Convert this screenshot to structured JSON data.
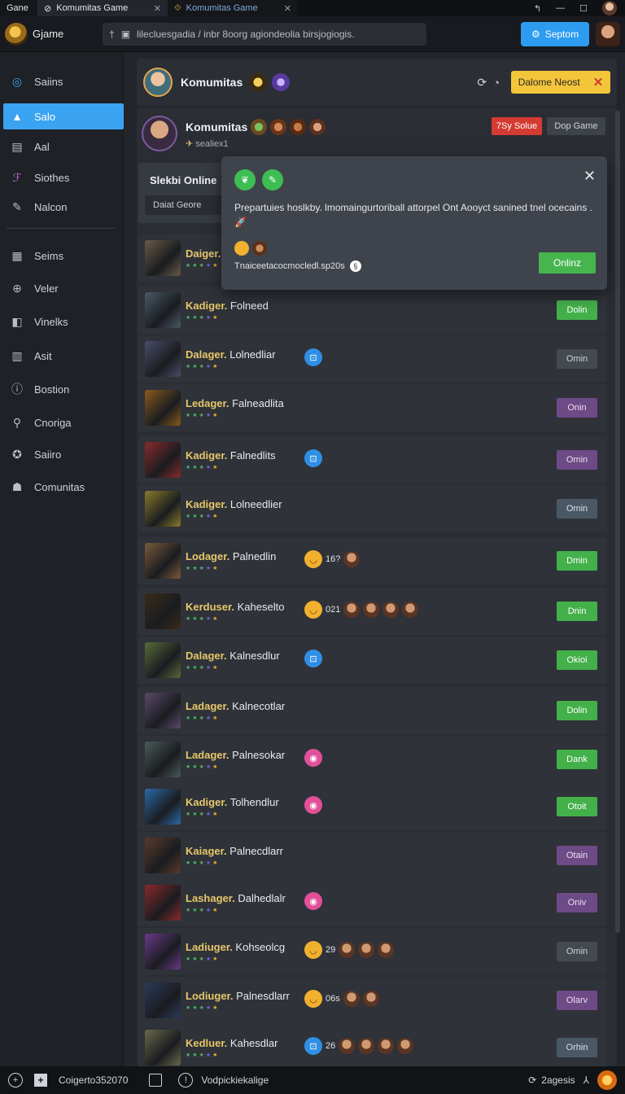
{
  "browser_tabs": [
    {
      "label": "Gane"
    },
    {
      "label": "Komumitas Game"
    },
    {
      "label": "Komumitas Game"
    }
  ],
  "appbar": {
    "brand": "Gjame",
    "address": "lilecluesgadia / inbr 8oorg agiondeolia birsjogiogis.",
    "primary_button": "Septom"
  },
  "sidebar": {
    "items": [
      {
        "label": "Saiins",
        "icon": "circle-icon"
      },
      {
        "label": "Salo",
        "icon": "triangle-icon",
        "active": true
      },
      {
        "label": "Aal",
        "icon": "bookmark-icon"
      },
      {
        "label": "Siothes",
        "icon": "purple-logo-icon"
      },
      {
        "label": "Nalcon",
        "icon": "pencil-icon"
      },
      {
        "label": "Seims",
        "icon": "grid-icon"
      },
      {
        "label": "Veler",
        "icon": "globe-icon"
      },
      {
        "label": "Vinelks",
        "icon": "square-icon"
      },
      {
        "label": "Asit",
        "icon": "bars-icon"
      },
      {
        "label": "Bostion",
        "icon": "info-icon"
      },
      {
        "label": "Cnoriga",
        "icon": "link-icon"
      },
      {
        "label": "Saiiro",
        "icon": "badge-icon"
      },
      {
        "label": "Comunitas",
        "icon": "stack-icon"
      }
    ]
  },
  "header": {
    "title": "Komumitas",
    "action_button": "Dalome Neost"
  },
  "profile": {
    "title": "Komumitas",
    "subtitle": "sealiex1",
    "red_button": "7Sy Solue",
    "gray_button": "Dop Game"
  },
  "subcard": {
    "heading": "Slekbi Online",
    "select": "Daiat Geore"
  },
  "popup": {
    "message": "Prepartuies hoslkby. lmomaingurtoriball attorpel Ont Aooyct sanined tnel ocecains .",
    "footer": "Tnaiceetacocmocledl.sp20s",
    "ok_button": "Onlinz"
  },
  "rows": [
    {
      "prefix": "Daiger.",
      "name": "",
      "status": "",
      "status_color": "green",
      "thumb": "#6a5a48",
      "react": null
    },
    {
      "prefix": "Kadiger.",
      "name": "Folneed",
      "status": "Dolin",
      "status_color": "green",
      "thumb": "#4a5a64",
      "react": null
    },
    {
      "prefix": "Dalager.",
      "name": "Lolnedliar",
      "status": "Omin",
      "status_color": "gray",
      "thumb": "#4a4e6a",
      "react": {
        "kind": "blue"
      }
    },
    {
      "prefix": "Ledager.",
      "name": "Falneadlita",
      "status": "Onin",
      "status_color": "purple",
      "thumb": "#8a5a1a",
      "react": null
    },
    {
      "prefix": "Kadiger.",
      "name": "Falnedlits",
      "status": "Omin",
      "status_color": "purple",
      "thumb": "#8a2a2a",
      "react": {
        "kind": "blue"
      }
    },
    {
      "prefix": "Kadiger.",
      "name": "Lolneedlier",
      "status": "Omin",
      "status_color": "slate",
      "thumb": "#8a7a2a",
      "react": null
    },
    {
      "prefix": "Lodager.",
      "name": "Palnedlin",
      "status": "Dmin",
      "status_color": "green",
      "thumb": "#7a5a3a",
      "react": {
        "kind": "smile",
        "count": "16?",
        "faces": 1
      }
    },
    {
      "prefix": "Kerduser.",
      "name": "Kaheselto",
      "status": "Dnin",
      "status_color": "green",
      "thumb": "#3a2a1a",
      "react": {
        "kind": "smile",
        "count": "021",
        "faces": 4
      }
    },
    {
      "prefix": "Dalager.",
      "name": "Kalnesdlur",
      "status": "Okioi",
      "status_color": "green",
      "thumb": "#5a6a3a",
      "react": {
        "kind": "blue"
      }
    },
    {
      "prefix": "Ladager.",
      "name": "Kalnecotlar",
      "status": "Dolin",
      "status_color": "green",
      "thumb": "#5a4a6a",
      "react": null
    },
    {
      "prefix": "Ladager.",
      "name": "Palnesokar",
      "status": "Dank",
      "status_color": "green",
      "thumb": "#4a5a5a",
      "react": {
        "kind": "pink"
      }
    },
    {
      "prefix": "Kadiger.",
      "name": "Tolhendlur",
      "status": "Otoit",
      "status_color": "green",
      "thumb": "#2a6aa8",
      "react": {
        "kind": "pink"
      }
    },
    {
      "prefix": "Kaiager.",
      "name": "Palnecdlarr",
      "status": "Otain",
      "status_color": "purple",
      "thumb": "#5a3a2a",
      "react": null
    },
    {
      "prefix": "Lashager.",
      "name": "Dalhedlalr",
      "status": "Oniv",
      "status_color": "purple",
      "thumb": "#8a2a2a",
      "react": {
        "kind": "pink"
      }
    },
    {
      "prefix": "Ladiuger.",
      "name": "Kohseolcg",
      "status": "Omin",
      "status_color": "gray",
      "thumb": "#6a3a8a",
      "react": {
        "kind": "smile",
        "count": "29",
        "faces": 3
      }
    },
    {
      "prefix": "Lodiuger.",
      "name": "Palnesdlarr",
      "status": "Olarv",
      "status_color": "purple",
      "thumb": "#2a3a5a",
      "react": {
        "kind": "smile",
        "count": "06s",
        "faces": 2
      }
    },
    {
      "prefix": "Kedluer.",
      "name": "Kahesdlar",
      "status": "Orhin",
      "status_color": "slate",
      "thumb": "#6a6a4a",
      "react": {
        "kind": "blue",
        "count": "26",
        "faces": 4
      }
    }
  ],
  "statusbar": {
    "left_text": "Coigerto352070",
    "mid_text": "Vodpickiekalige",
    "right_text": "2agesis"
  }
}
